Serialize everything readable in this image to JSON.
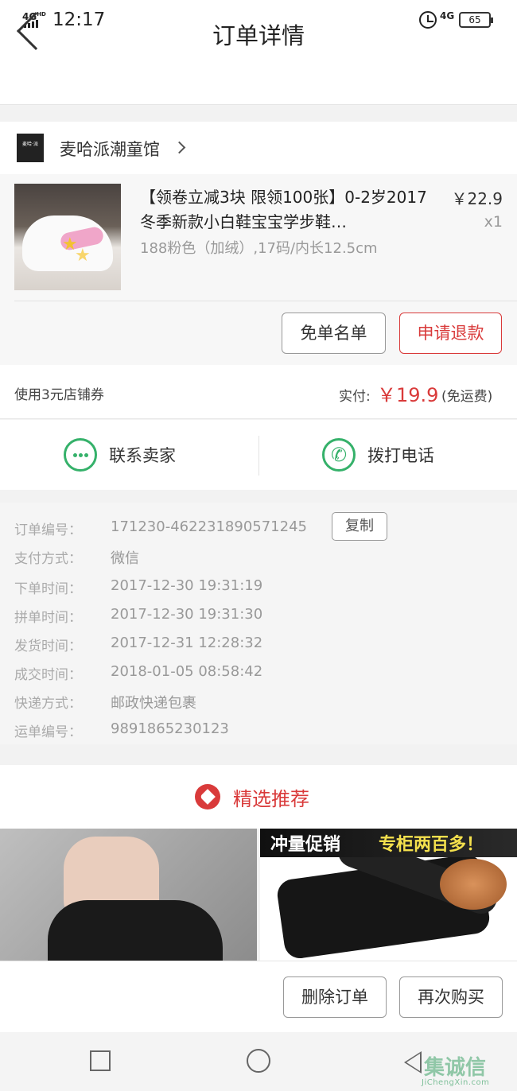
{
  "status_bar": {
    "network": "4G",
    "network_sup": "HD",
    "time": "12:17",
    "cell": "4G",
    "battery": "65"
  },
  "nav": {
    "title": "订单详情"
  },
  "shop": {
    "name": "麦哈派潮童馆",
    "logo_text": "麦哈·派"
  },
  "product": {
    "title": "【领卷立减3块 限领100张】0-2岁2017冬季新款小白鞋宝宝学步鞋…",
    "spec": "188粉色（加绒）,17码/内长12.5cm",
    "price": "￥22.9",
    "quantity": "x1"
  },
  "order_actions": {
    "free_list": "免单名单",
    "refund": "申请退款"
  },
  "payment": {
    "coupon": "使用3元店铺券",
    "paid_label": "实付:",
    "amount": "￥19.9",
    "shipping_note": "(免运费)"
  },
  "contact": {
    "seller": "联系卖家",
    "phone": "拨打电话"
  },
  "order_info": {
    "copy_label": "复制",
    "rows": [
      {
        "key": "订单编号：",
        "value": "171230-462231890571245"
      },
      {
        "key": "支付方式：",
        "value": "微信"
      },
      {
        "key": "下单时间：",
        "value": "2017-12-30 19:31:19"
      },
      {
        "key": "拼单时间：",
        "value": "2017-12-30 19:31:30"
      },
      {
        "key": "发货时间：",
        "value": "2017-12-31 12:28:32"
      },
      {
        "key": "成交时间：",
        "value": "2018-01-05 08:58:42"
      },
      {
        "key": "快递方式：",
        "value": "邮政快递包裹"
      },
      {
        "key": "运单编号：",
        "value": "9891865230123"
      }
    ]
  },
  "recommend": {
    "title": "精选推荐",
    "promo_left": "冲量促销",
    "promo_right": "专柜两百多！"
  },
  "bottom_actions": {
    "delete": "删除订单",
    "rebuy": "再次购买"
  },
  "watermark": {
    "main": "集诚信",
    "sub": "JiChengXin.com"
  },
  "colors": {
    "accent_red": "#d93a3a",
    "contact_green": "#35b16a"
  },
  "icons": [
    "back-arrow-icon",
    "chevron-right-icon",
    "chat-icon",
    "phone-icon",
    "heart-icon",
    "square-icon",
    "circle-icon",
    "triangle-back-icon"
  ]
}
